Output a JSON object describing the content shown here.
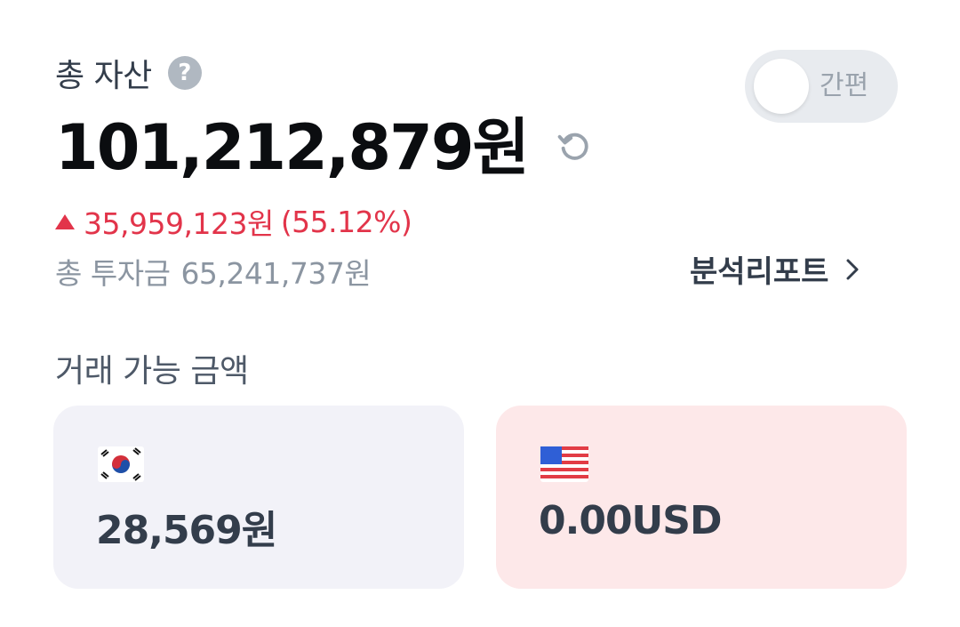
{
  "header": {
    "title": "총 자산",
    "help_icon": "question-circle-icon",
    "toggle": {
      "label": "간편",
      "state": "off"
    }
  },
  "total": {
    "amount": "101,212,879원",
    "refresh_icon": "refresh-icon"
  },
  "change": {
    "direction": "up",
    "amount": "35,959,123원",
    "percent": "(55.12%)",
    "color": "#e2344a"
  },
  "investment": {
    "label": "총 투자금",
    "amount": "65,241,737원"
  },
  "report_link": {
    "label": "분석리포트",
    "icon": "chevron-right-icon"
  },
  "available": {
    "title": "거래 가능 금액",
    "cards": [
      {
        "flag": "korea-flag-icon",
        "amount": "28,569원",
        "background": "#f2f2f8"
      },
      {
        "flag": "usa-flag-icon",
        "amount": "0.00USD",
        "background": "#fde8e9"
      }
    ]
  }
}
